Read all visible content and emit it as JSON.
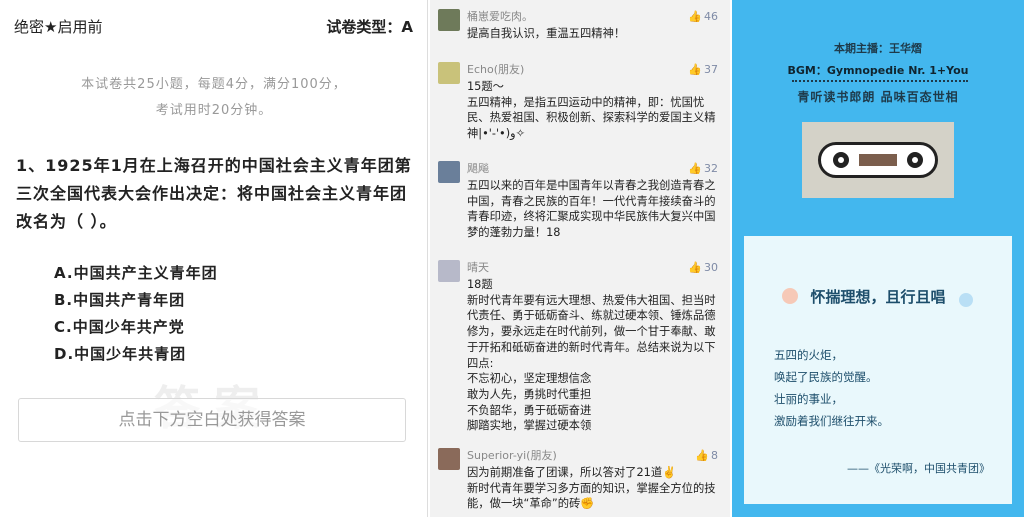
{
  "exam": {
    "secret_label": "绝密★启用前",
    "type_label": "试卷类型：A",
    "note_line1": "本试卷共25小题，每题4分，满分100分，",
    "note_line2": "考试用时20分钟。",
    "question": "1、1925年1月在上海召开的中国社会主义青年团第三次全国代表大会作出决定：将中国社会主义青年团改名为（ ）。",
    "options": [
      "A.中国共产主义青年团",
      "B.中国共产青年团",
      "C.中国少年共产党",
      "D.中国少年共青团"
    ],
    "watermark": "答案",
    "answer_button": "点击下方空白处获得答案"
  },
  "comments": [
    {
      "name": "桶崽爱吃肉。",
      "likes": "46",
      "body": "提高自我认识，重温五四精神！",
      "avatar_color": "#6e7a5a"
    },
    {
      "name": "Echo(朋友)",
      "likes": "37",
      "body": "15题～\n五四精神，是指五四运动中的精神，即：忧国忧民、热爱祖国、积极创新、探索科学的爱国主义精神|•'-'•)و✧",
      "avatar_color": "#c9c27a"
    },
    {
      "name": "飓飚",
      "likes": "32",
      "body": "五四以来的百年是中国青年以青春之我创造青春之中国，青春之民族的百年！一代代青年接续奋斗的青春印迹，终将汇聚成实现中华民族伟大复兴中国梦的蓬勃力量！18",
      "avatar_color": "#6a7f9a"
    },
    {
      "name": "晴天",
      "likes": "30",
      "body": "18题\n新时代青年要有远大理想、热爱伟大祖国、担当时代责任、勇于砥砺奋斗、练就过硬本领、锤炼品德修为，要永远走在时代前列，做一个甘于奉献、敢于开拓和砥砺奋进的新时代青年。总结来说为以下四点:\n不忘初心，坚定理想信念\n敢为人先，勇挑时代重担\n不负韶华，勇于砥砺奋进\n脚踏实地，掌握过硬本领",
      "avatar_color": "#b7b9c9"
    },
    {
      "name": "Superior-yi(朋友)",
      "likes": "8",
      "body": "因为前期准备了团课，所以答对了21道✌️\n新时代青年要学习多方面的知识，掌握全方位的技能，做一块“革命”的砖✊",
      "avatar_color": "#8a6a5a"
    }
  ],
  "podcast": {
    "host": "本期主播：王华熠",
    "bgm": "BGM：Gymnopedie Nr. 1+You",
    "slogan": "青听读书郎朗  品味百态世相",
    "poem_title": "怀揣理想，且行且唱",
    "poem_lines": [
      "五四的火炬，",
      "唤起了民族的觉醒。",
      "壮丽的事业，",
      "激励着我们继往开来。"
    ],
    "poem_source": "——《光荣啊，中国共青团》"
  },
  "icons": {
    "like": "thumbs-up-icon",
    "cassette": "cassette-tape-icon"
  }
}
